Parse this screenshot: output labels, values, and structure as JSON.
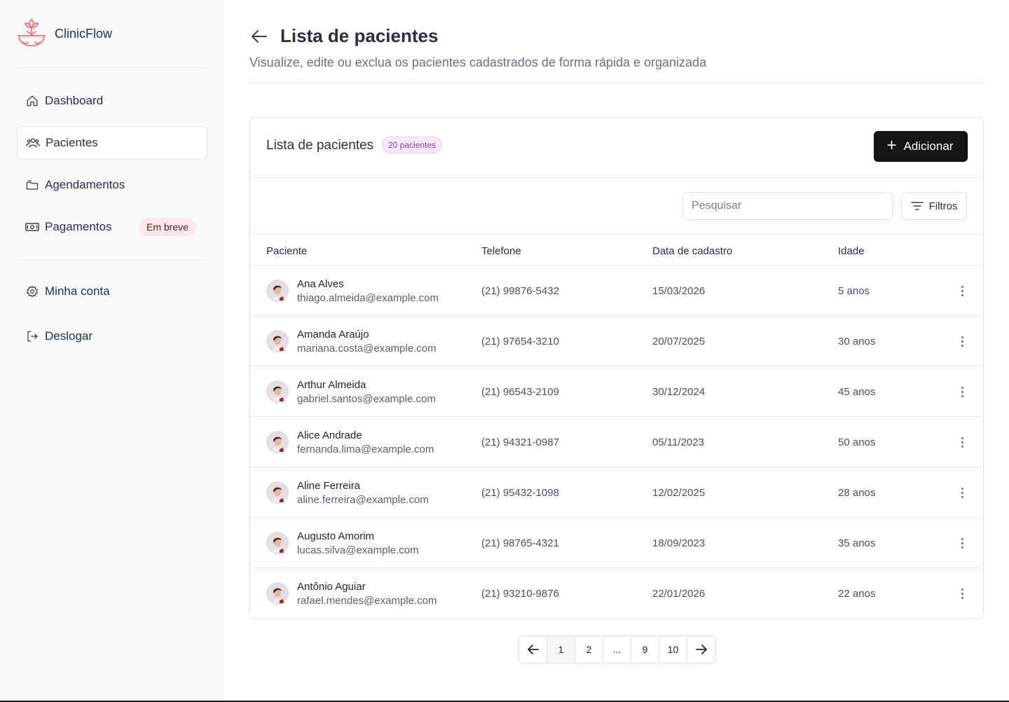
{
  "app": {
    "name": "ClinicFlow"
  },
  "sidebar": {
    "items": [
      {
        "label": "Dashboard"
      },
      {
        "label": "Pacientes"
      },
      {
        "label": "Agendamentos"
      },
      {
        "label": "Pagamentos",
        "badge": "Em breve"
      },
      {
        "label": "Minha conta"
      },
      {
        "label": "Deslogar"
      }
    ]
  },
  "header": {
    "title": "Lista de pacientes",
    "subtitle": "Visualize, edite ou exclua os pacientes cadastrados de forma rápida e organizada"
  },
  "card": {
    "title": "Lista de pacientes",
    "count_badge": "20 pacientes",
    "add_label": "Adicionar",
    "search_placeholder": "Pesquisar",
    "filter_label": "Filtros"
  },
  "table": {
    "columns": [
      "Paciente",
      "Telefone",
      "Data de cadastro",
      "Idade"
    ],
    "rows": [
      {
        "name": "Ana Alves",
        "email": "thiago.almeida@example.com",
        "phone": "(21) 99876-5432",
        "date": "15/03/2026",
        "age": "5 anos"
      },
      {
        "name": "Amanda Araújo",
        "email": "mariana.costa@example.com",
        "phone": "(21) 97654-3210",
        "date": "20/07/2025",
        "age": "30 anos"
      },
      {
        "name": "Arthur Almeida",
        "email": "gabriel.santos@example.com",
        "phone": "(21) 96543-2109",
        "date": "30/12/2024",
        "age": "45 anos"
      },
      {
        "name": "Alice Andrade",
        "email": "fernanda.lima@example.com",
        "phone": "(21) 94321-0987",
        "date": "05/11/2023",
        "age": "50 anos"
      },
      {
        "name": "Aline Ferreira",
        "email": "aline.ferreira@example.com",
        "phone": "(21) 95432-1098",
        "date": "12/02/2025",
        "age": "28 anos"
      },
      {
        "name": "Augusto Amorim",
        "email": "lucas.silva@example.com",
        "phone": "(21) 98765-4321",
        "date": "18/09/2023",
        "age": "35 anos"
      },
      {
        "name": "Antônio Aguiar",
        "email": "rafael.mendes@example.com",
        "phone": "(21) 93210-9876",
        "date": "22/01/2026",
        "age": "22 anos"
      }
    ]
  },
  "pagination": {
    "pages": [
      "1",
      "2",
      "...",
      "9",
      "10"
    ],
    "current": "1"
  },
  "colors": {
    "accent": "#151515",
    "badge_purple": "#8b3fc2",
    "badge_pink": "#fde7ea",
    "logo": "#f07c7c"
  }
}
